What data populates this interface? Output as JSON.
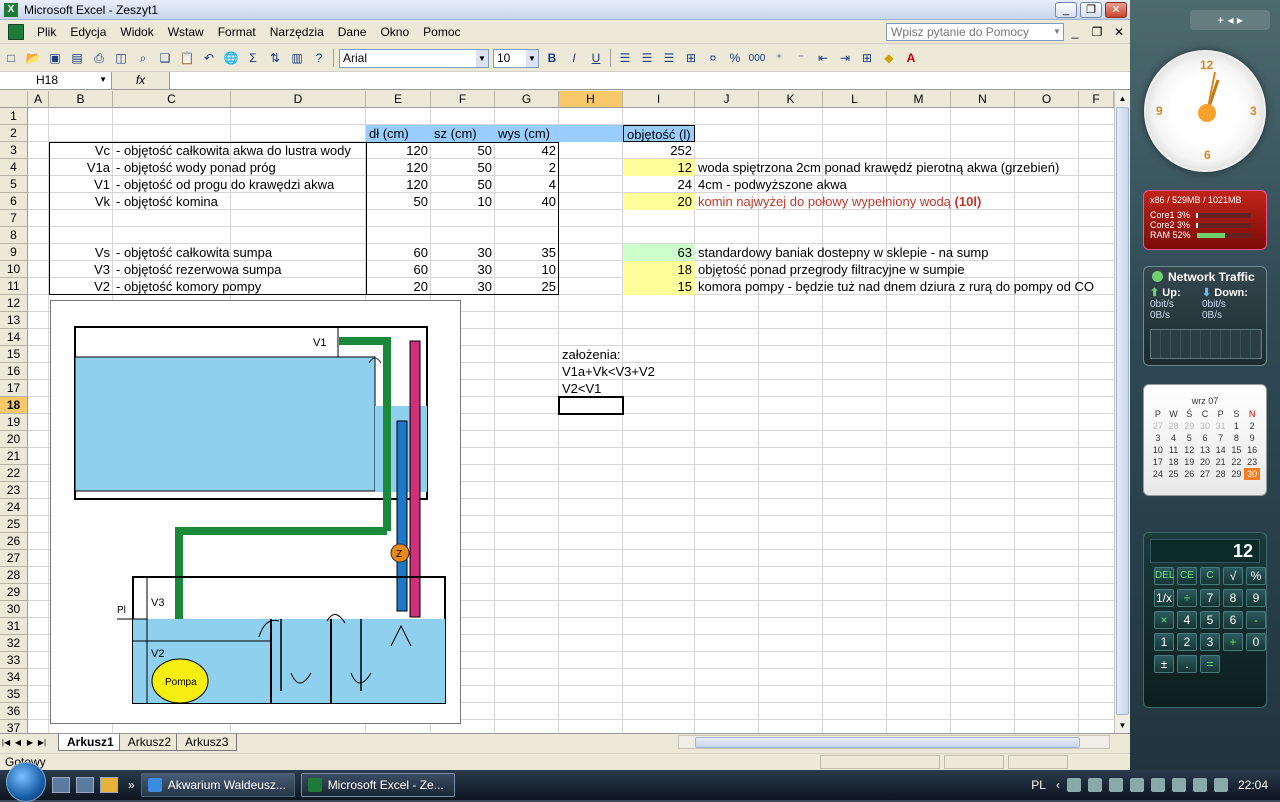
{
  "window": {
    "title": "Microsoft Excel - Zeszyt1",
    "minimize": "_",
    "restore": "❐",
    "close": "✕"
  },
  "menu": [
    "Plik",
    "Edycja",
    "Widok",
    "Wstaw",
    "Format",
    "Narzędzia",
    "Dane",
    "Okno",
    "Pomoc"
  ],
  "help_placeholder": "Wpisz pytanie do Pomocy",
  "toolbar": {
    "font": "Arial",
    "size": "10",
    "bold": "B",
    "italic": "I",
    "underline": "U",
    "percent": "%",
    "thousands": "000",
    "sigma": "Σ",
    "fx": "fx"
  },
  "namebox": "H18",
  "columns": [
    "A",
    "B",
    "C",
    "D",
    "E",
    "F",
    "G",
    "H",
    "I",
    "J",
    "K",
    "L",
    "M",
    "N",
    "O",
    "F"
  ],
  "rows": [
    "1",
    "2",
    "3",
    "4",
    "5",
    "6",
    "7",
    "8",
    "9",
    "10",
    "11",
    "12",
    "13",
    "14",
    "15",
    "16",
    "17",
    "18",
    "19",
    "20",
    "21",
    "22",
    "23",
    "24",
    "25",
    "26",
    "27",
    "28",
    "29",
    "30",
    "31",
    "32",
    "33",
    "34",
    "35",
    "36",
    "37"
  ],
  "headers": {
    "E": "dł (cm)",
    "F": "sz (cm)",
    "G": "wys (cm)",
    "I": "objętość (l)"
  },
  "table": [
    {
      "b": "Vc",
      "c": "- objętość całkowita akwa do lustra wody",
      "e": "120",
      "f": "50",
      "g": "42",
      "i": "252",
      "j": "",
      "fill": "none",
      "red": false
    },
    {
      "b": "V1a",
      "c": "- objętość wody ponad próg",
      "e": "120",
      "f": "50",
      "g": "2",
      "i": "12",
      "j": "woda spiętrzona 2cm ponad krawędź pierotną akwa (grzebień)",
      "fill": "yellow",
      "red": false
    },
    {
      "b": "V1",
      "c": "- objętość od progu do krawędzi akwa",
      "e": "120",
      "f": "50",
      "g": "4",
      "i": "24",
      "j": "4cm - podwyższone akwa",
      "fill": "none",
      "red": false
    },
    {
      "b": "Vk",
      "c": "- objętość komina",
      "e": "50",
      "f": "10",
      "g": "40",
      "i": "20",
      "j": "komin najwyżej do połowy wypełniony wodą",
      "jb": "(10l)",
      "fill": "yellow",
      "red": true
    },
    {
      "b": "Vs",
      "c": "- objętość całkowita sumpa",
      "e": "60",
      "f": "30",
      "g": "35",
      "i": "63",
      "j": "standardowy baniak dostepny w sklepie - na sump",
      "fill": "green",
      "red": false
    },
    {
      "b": "V3",
      "c": "- objętość rezerwowa sumpa",
      "e": "60",
      "f": "30",
      "g": "10",
      "i": "18",
      "j": "objętość ponad przegrody filtracyjne w sumpie",
      "fill": "yellow",
      "red": false
    },
    {
      "b": "V2",
      "c": "- objętość komory pompy",
      "e": "20",
      "f": "30",
      "g": "25",
      "i": "15",
      "j": "komora pompy - będzie tuż nad dnem dziura z rurą do pompy od CO",
      "fill": "yellow",
      "red": false
    }
  ],
  "notes": [
    "założenia:",
    "V1a+Vk<V3+V2",
    "V2<V1"
  ],
  "diagram": {
    "v1": "V1",
    "v3": "V3",
    "v2": "V2",
    "pl": "Pl",
    "pompa": "Pompa",
    "z": "Z"
  },
  "sheets": [
    "Arkusz1",
    "Arkusz2",
    "Arkusz3"
  ],
  "status": "Gotowy",
  "taskbar": {
    "items": [
      "Akwarium Waldeusz...",
      "Microsoft Excel - Ze..."
    ],
    "lang": "PL",
    "time": "22:04"
  },
  "gadgets": {
    "cpu": {
      "head": "x86 / 529MB / 1021MB",
      "core1": "Core1",
      "core1_val": "3%",
      "core2": "Core2",
      "core2_val": "3%",
      "ram": "RAM",
      "ram_val": "52%",
      "core1_pct": 0.03,
      "core2_pct": 0.03,
      "ram_pct": 0.52
    },
    "net": {
      "title": "Network Traffic",
      "up": "Up:",
      "down": "Down:",
      "up_bits": "0bit/s",
      "up_bytes": "0B/s",
      "down_bits": "0bit/s",
      "down_bytes": "0B/s"
    },
    "cal": {
      "month": "wrz 07",
      "days": [
        "P",
        "W",
        "Ś",
        "C",
        "P",
        "S",
        "N"
      ],
      "weeks": [
        [
          "27",
          "28",
          "29",
          "30",
          "31",
          "1",
          "2"
        ],
        [
          "3",
          "4",
          "5",
          "6",
          "7",
          "8",
          "9"
        ],
        [
          "10",
          "11",
          "12",
          "13",
          "14",
          "15",
          "16"
        ],
        [
          "17",
          "18",
          "19",
          "20",
          "21",
          "22",
          "23"
        ],
        [
          "24",
          "25",
          "26",
          "27",
          "28",
          "29",
          "30"
        ]
      ]
    },
    "calc": {
      "display": "12",
      "keys": [
        "DEL",
        "",
        "CE",
        "C",
        "",
        "√",
        "%",
        "1/x",
        "÷",
        "",
        "7",
        "8",
        "9",
        "×",
        "",
        "4",
        "5",
        "6",
        "-",
        "",
        "1",
        "2",
        "3",
        "+",
        "",
        "0",
        "±",
        ".",
        "=",
        ""
      ]
    }
  }
}
